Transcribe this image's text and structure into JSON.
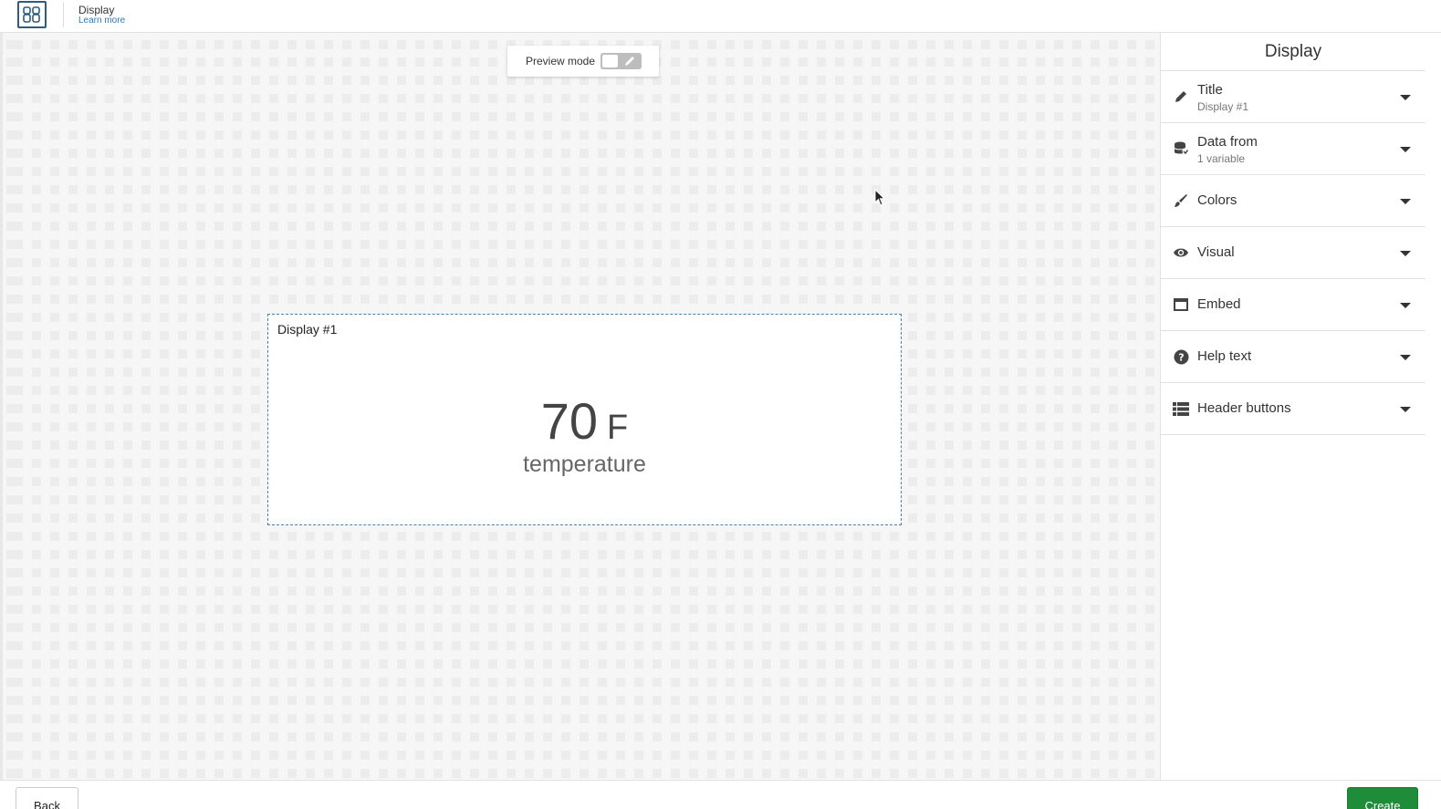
{
  "header": {
    "logo_icon": "display-widget-icon",
    "title": "Display",
    "learn_more": "Learn more"
  },
  "canvas": {
    "preview_label": "Preview mode",
    "preview_enabled": false,
    "widget": {
      "title": "Display #1",
      "value": "70",
      "unit": "F",
      "variable": "temperature"
    }
  },
  "panel": {
    "title": "Display",
    "sections": [
      {
        "label": "Title",
        "sub": "Display #1",
        "icon": "pencil-icon"
      },
      {
        "label": "Data from",
        "sub": "1 variable",
        "icon": "database-icon"
      },
      {
        "label": "Colors",
        "sub": "",
        "icon": "brush-icon"
      },
      {
        "label": "Visual",
        "sub": "",
        "icon": "eye-icon"
      },
      {
        "label": "Embed",
        "sub": "",
        "icon": "window-icon"
      },
      {
        "label": "Help text",
        "sub": "",
        "icon": "question-circle-icon"
      },
      {
        "label": "Header buttons",
        "sub": "",
        "icon": "list-icon"
      }
    ]
  },
  "footer": {
    "back_label": "Back",
    "create_label": "Create"
  },
  "colors": {
    "accent_blue": "#2a7ab8",
    "create_green": "#1f8c3a",
    "logo_blue": "#2d5d82"
  }
}
